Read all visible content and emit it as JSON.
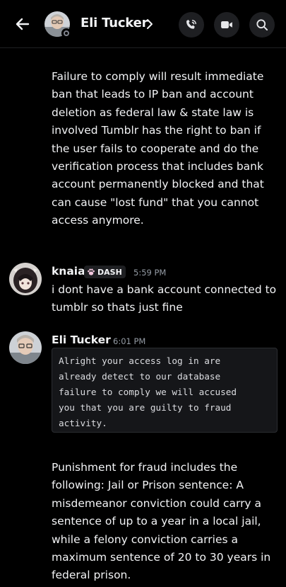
{
  "header": {
    "title": "Eli Tucker",
    "back_icon": "arrow-left-icon",
    "chevron_icon": "chevron-right-icon",
    "actions": [
      {
        "name": "voice-call-button",
        "icon": "phone-call-icon"
      },
      {
        "name": "video-call-button",
        "icon": "video-camera-icon"
      },
      {
        "name": "search-button",
        "icon": "search-icon"
      }
    ]
  },
  "messages": [
    {
      "type": "continuation",
      "text": "Failure to comply will result immediate ban that leads to IP ban and account deletion as federal law & state law is involved Tumblr has the right to ban if the user fails to cooperate and do the verification process that includes bank account permanently blocked and that can cause \"lost fund\" that you cannot access anymore."
    },
    {
      "type": "group",
      "author": "knaia",
      "badge": "DASH",
      "badge_icon": "paw-icon",
      "timestamp": "5:59 PM",
      "text": "i dont have a bank account connected to tumblr so thats just fine"
    },
    {
      "type": "group",
      "author": "Eli Tucker",
      "timestamp": "6:01 PM",
      "code": "Alright your access log in are\nalready detect to our database\nfailure to comply we will accused\nyou that you are guilty to fraud\nactivity."
    },
    {
      "type": "continuation",
      "text": "Punishment for fraud includes the following: Jail or Prison sentence: A misdemeanor conviction could carry a sentence of up to a year in a local jail, while a felony conviction carries a maximum sentence of 20 to 30 years in federal prison."
    }
  ],
  "colors": {
    "background": "#000000",
    "text": "#f2f3f5",
    "muted": "#949ba4",
    "button_bg": "#1e1f22",
    "code_bg": "#151619"
  }
}
